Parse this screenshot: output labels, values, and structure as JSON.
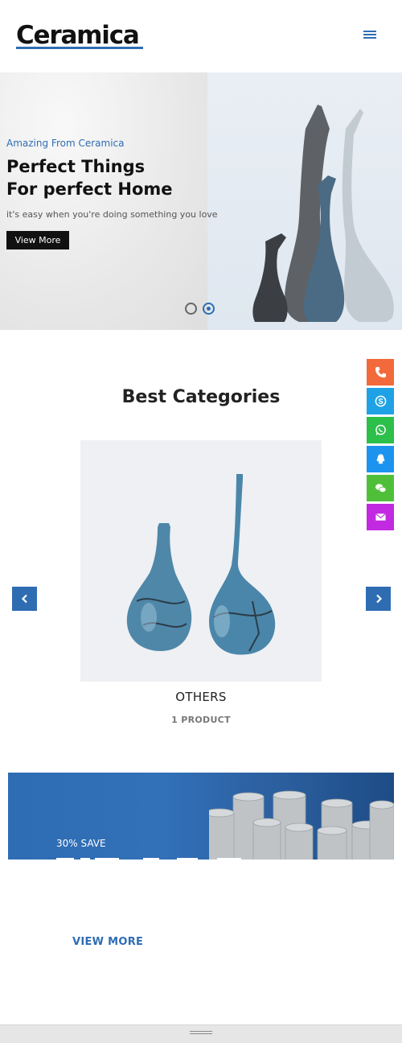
{
  "header": {
    "logo": "Ceramica",
    "menu_icon": "hamburger-menu-icon",
    "accent_color": "#2f6db3"
  },
  "hero": {
    "overline": "Amazing From Ceramica",
    "title_line1": "Perfect Things",
    "title_line2": "For perfect Home",
    "subtitle": "it's easy when you're doing something you love",
    "button_label": "View More",
    "slides": 2,
    "active_slide": 2
  },
  "contact_bar": {
    "items": [
      {
        "icon": "phone-icon",
        "color": "#f26a3b"
      },
      {
        "icon": "skype-icon",
        "color": "#1fa2e5"
      },
      {
        "icon": "whatsapp-icon",
        "color": "#2cbf4a"
      },
      {
        "icon": "qq-icon",
        "color": "#1d93f0"
      },
      {
        "icon": "wechat-icon",
        "color": "#4fbf3a"
      },
      {
        "icon": "email-icon",
        "color": "#c12ae0"
      }
    ]
  },
  "categories": {
    "title": "Best Categories",
    "item": {
      "name": "OTHERS",
      "count": "1 PRODUCT"
    },
    "prev_icon": "chevron-left-icon",
    "next_icon": "chevron-right-icon"
  },
  "promo": {
    "badge": "30% SAVE"
  },
  "view_more": "VIEW MORE"
}
